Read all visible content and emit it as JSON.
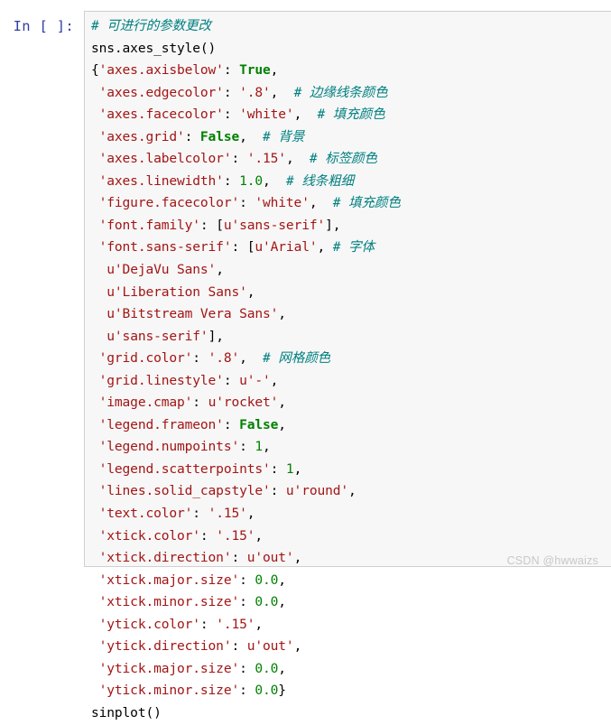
{
  "cell": {
    "prompt": "In [ ]:",
    "background_color": "#f7f7f7",
    "border_color": "#cfcfcf",
    "lines": [
      [
        {
          "t": "comment",
          "v": "# 可进行的参数更改"
        }
      ],
      [
        {
          "t": "plain",
          "v": "sns.axes_style()"
        }
      ],
      [
        {
          "t": "punct",
          "v": "{"
        },
        {
          "t": "string",
          "v": "'axes.axisbelow'"
        },
        {
          "t": "punct",
          "v": ": "
        },
        {
          "t": "kw",
          "v": "True"
        },
        {
          "t": "punct",
          "v": ","
        }
      ],
      [
        {
          "t": "punct",
          "v": " "
        },
        {
          "t": "string",
          "v": "'axes.edgecolor'"
        },
        {
          "t": "punct",
          "v": ": "
        },
        {
          "t": "string",
          "v": "'.8'"
        },
        {
          "t": "punct",
          "v": ",  "
        },
        {
          "t": "comment",
          "v": "# 边缘线条颜色"
        }
      ],
      [
        {
          "t": "punct",
          "v": " "
        },
        {
          "t": "string",
          "v": "'axes.facecolor'"
        },
        {
          "t": "punct",
          "v": ": "
        },
        {
          "t": "string",
          "v": "'white'"
        },
        {
          "t": "punct",
          "v": ",  "
        },
        {
          "t": "comment",
          "v": "# 填充颜色"
        }
      ],
      [
        {
          "t": "punct",
          "v": " "
        },
        {
          "t": "string",
          "v": "'axes.grid'"
        },
        {
          "t": "punct",
          "v": ": "
        },
        {
          "t": "kw",
          "v": "False"
        },
        {
          "t": "punct",
          "v": ",  "
        },
        {
          "t": "comment",
          "v": "# 背景"
        }
      ],
      [
        {
          "t": "punct",
          "v": " "
        },
        {
          "t": "string",
          "v": "'axes.labelcolor'"
        },
        {
          "t": "punct",
          "v": ": "
        },
        {
          "t": "string",
          "v": "'.15'"
        },
        {
          "t": "punct",
          "v": ",  "
        },
        {
          "t": "comment",
          "v": "# 标签颜色"
        }
      ],
      [
        {
          "t": "punct",
          "v": " "
        },
        {
          "t": "string",
          "v": "'axes.linewidth'"
        },
        {
          "t": "punct",
          "v": ": "
        },
        {
          "t": "num",
          "v": "1.0"
        },
        {
          "t": "punct",
          "v": ",  "
        },
        {
          "t": "comment",
          "v": "# 线条粗细"
        }
      ],
      [
        {
          "t": "punct",
          "v": " "
        },
        {
          "t": "string",
          "v": "'figure.facecolor'"
        },
        {
          "t": "punct",
          "v": ": "
        },
        {
          "t": "string",
          "v": "'white'"
        },
        {
          "t": "punct",
          "v": ",  "
        },
        {
          "t": "comment",
          "v": "# 填充颜色"
        }
      ],
      [
        {
          "t": "punct",
          "v": " "
        },
        {
          "t": "string",
          "v": "'font.family'"
        },
        {
          "t": "punct",
          "v": ": ["
        },
        {
          "t": "string",
          "v": "u'sans-serif'"
        },
        {
          "t": "punct",
          "v": "],"
        }
      ],
      [
        {
          "t": "punct",
          "v": " "
        },
        {
          "t": "string",
          "v": "'font.sans-serif'"
        },
        {
          "t": "punct",
          "v": ": ["
        },
        {
          "t": "string",
          "v": "u'Arial'"
        },
        {
          "t": "punct",
          "v": ", "
        },
        {
          "t": "comment",
          "v": "# 字体"
        }
      ],
      [
        {
          "t": "punct",
          "v": "  "
        },
        {
          "t": "string",
          "v": "u'DejaVu Sans'"
        },
        {
          "t": "punct",
          "v": ","
        }
      ],
      [
        {
          "t": "punct",
          "v": "  "
        },
        {
          "t": "string",
          "v": "u'Liberation Sans'"
        },
        {
          "t": "punct",
          "v": ","
        }
      ],
      [
        {
          "t": "punct",
          "v": "  "
        },
        {
          "t": "string",
          "v": "u'Bitstream Vera Sans'"
        },
        {
          "t": "punct",
          "v": ","
        }
      ],
      [
        {
          "t": "punct",
          "v": "  "
        },
        {
          "t": "string",
          "v": "u'sans-serif'"
        },
        {
          "t": "punct",
          "v": "],"
        }
      ],
      [
        {
          "t": "punct",
          "v": " "
        },
        {
          "t": "string",
          "v": "'grid.color'"
        },
        {
          "t": "punct",
          "v": ": "
        },
        {
          "t": "string",
          "v": "'.8'"
        },
        {
          "t": "punct",
          "v": ",  "
        },
        {
          "t": "comment",
          "v": "# 网格颜色"
        }
      ],
      [
        {
          "t": "punct",
          "v": " "
        },
        {
          "t": "string",
          "v": "'grid.linestyle'"
        },
        {
          "t": "punct",
          "v": ": "
        },
        {
          "t": "string",
          "v": "u'-'"
        },
        {
          "t": "punct",
          "v": ","
        }
      ],
      [
        {
          "t": "punct",
          "v": " "
        },
        {
          "t": "string",
          "v": "'image.cmap'"
        },
        {
          "t": "punct",
          "v": ": "
        },
        {
          "t": "string",
          "v": "u'rocket'"
        },
        {
          "t": "punct",
          "v": ","
        }
      ],
      [
        {
          "t": "punct",
          "v": " "
        },
        {
          "t": "string",
          "v": "'legend.frameon'"
        },
        {
          "t": "punct",
          "v": ": "
        },
        {
          "t": "kw",
          "v": "False"
        },
        {
          "t": "punct",
          "v": ","
        }
      ],
      [
        {
          "t": "punct",
          "v": " "
        },
        {
          "t": "string",
          "v": "'legend.numpoints'"
        },
        {
          "t": "punct",
          "v": ": "
        },
        {
          "t": "num",
          "v": "1"
        },
        {
          "t": "punct",
          "v": ","
        }
      ],
      [
        {
          "t": "punct",
          "v": " "
        },
        {
          "t": "string",
          "v": "'legend.scatterpoints'"
        },
        {
          "t": "punct",
          "v": ": "
        },
        {
          "t": "num",
          "v": "1"
        },
        {
          "t": "punct",
          "v": ","
        }
      ],
      [
        {
          "t": "punct",
          "v": " "
        },
        {
          "t": "string",
          "v": "'lines.solid_capstyle'"
        },
        {
          "t": "punct",
          "v": ": "
        },
        {
          "t": "string",
          "v": "u'round'"
        },
        {
          "t": "punct",
          "v": ","
        }
      ],
      [
        {
          "t": "punct",
          "v": " "
        },
        {
          "t": "string",
          "v": "'text.color'"
        },
        {
          "t": "punct",
          "v": ": "
        },
        {
          "t": "string",
          "v": "'.15'"
        },
        {
          "t": "punct",
          "v": ","
        }
      ],
      [
        {
          "t": "punct",
          "v": " "
        },
        {
          "t": "string",
          "v": "'xtick.color'"
        },
        {
          "t": "punct",
          "v": ": "
        },
        {
          "t": "string",
          "v": "'.15'"
        },
        {
          "t": "punct",
          "v": ","
        }
      ],
      [
        {
          "t": "punct",
          "v": " "
        },
        {
          "t": "string",
          "v": "'xtick.direction'"
        },
        {
          "t": "punct",
          "v": ": "
        },
        {
          "t": "string",
          "v": "u'out'"
        },
        {
          "t": "punct",
          "v": ","
        }
      ],
      [
        {
          "t": "punct",
          "v": " "
        },
        {
          "t": "string",
          "v": "'xtick.major.size'"
        },
        {
          "t": "punct",
          "v": ": "
        },
        {
          "t": "num",
          "v": "0.0"
        },
        {
          "t": "punct",
          "v": ","
        }
      ],
      [
        {
          "t": "punct",
          "v": " "
        },
        {
          "t": "string",
          "v": "'xtick.minor.size'"
        },
        {
          "t": "punct",
          "v": ": "
        },
        {
          "t": "num",
          "v": "0.0"
        },
        {
          "t": "punct",
          "v": ","
        }
      ],
      [
        {
          "t": "punct",
          "v": " "
        },
        {
          "t": "string",
          "v": "'ytick.color'"
        },
        {
          "t": "punct",
          "v": ": "
        },
        {
          "t": "string",
          "v": "'.15'"
        },
        {
          "t": "punct",
          "v": ","
        }
      ],
      [
        {
          "t": "punct",
          "v": " "
        },
        {
          "t": "string",
          "v": "'ytick.direction'"
        },
        {
          "t": "punct",
          "v": ": "
        },
        {
          "t": "string",
          "v": "u'out'"
        },
        {
          "t": "punct",
          "v": ","
        }
      ],
      [
        {
          "t": "punct",
          "v": " "
        },
        {
          "t": "string",
          "v": "'ytick.major.size'"
        },
        {
          "t": "punct",
          "v": ": "
        },
        {
          "t": "num",
          "v": "0.0"
        },
        {
          "t": "punct",
          "v": ","
        }
      ],
      [
        {
          "t": "punct",
          "v": " "
        },
        {
          "t": "string",
          "v": "'ytick.minor.size'"
        },
        {
          "t": "punct",
          "v": ": "
        },
        {
          "t": "num",
          "v": "0.0"
        },
        {
          "t": "punct",
          "v": "}"
        }
      ],
      [
        {
          "t": "plain",
          "v": "sinplot()"
        }
      ]
    ]
  },
  "watermark": {
    "text": "CSDN @hwwaizs"
  },
  "colors": {
    "comment": "#007f7f",
    "string": "#a31515",
    "keyword": "#008000",
    "number": "#008000",
    "prompt": "#303f9f",
    "cell_bg": "#f7f7f7",
    "cell_border": "#cfcfcf",
    "watermark": "#c8c8c8"
  }
}
